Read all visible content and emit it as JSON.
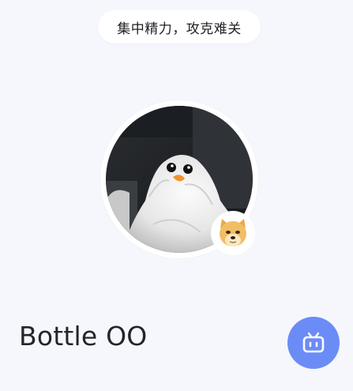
{
  "status": {
    "text": "集中精力，攻克难关"
  },
  "profile": {
    "avatar_icon": "penguin-towel-avatar",
    "badge_icon": "doge-icon",
    "username": "Bottle OO"
  },
  "actions": {
    "bot_button_icon": "robot-icon"
  },
  "colors": {
    "background": "#f6f7fc",
    "accent": "#6b8cf7",
    "text": "#23252b"
  }
}
